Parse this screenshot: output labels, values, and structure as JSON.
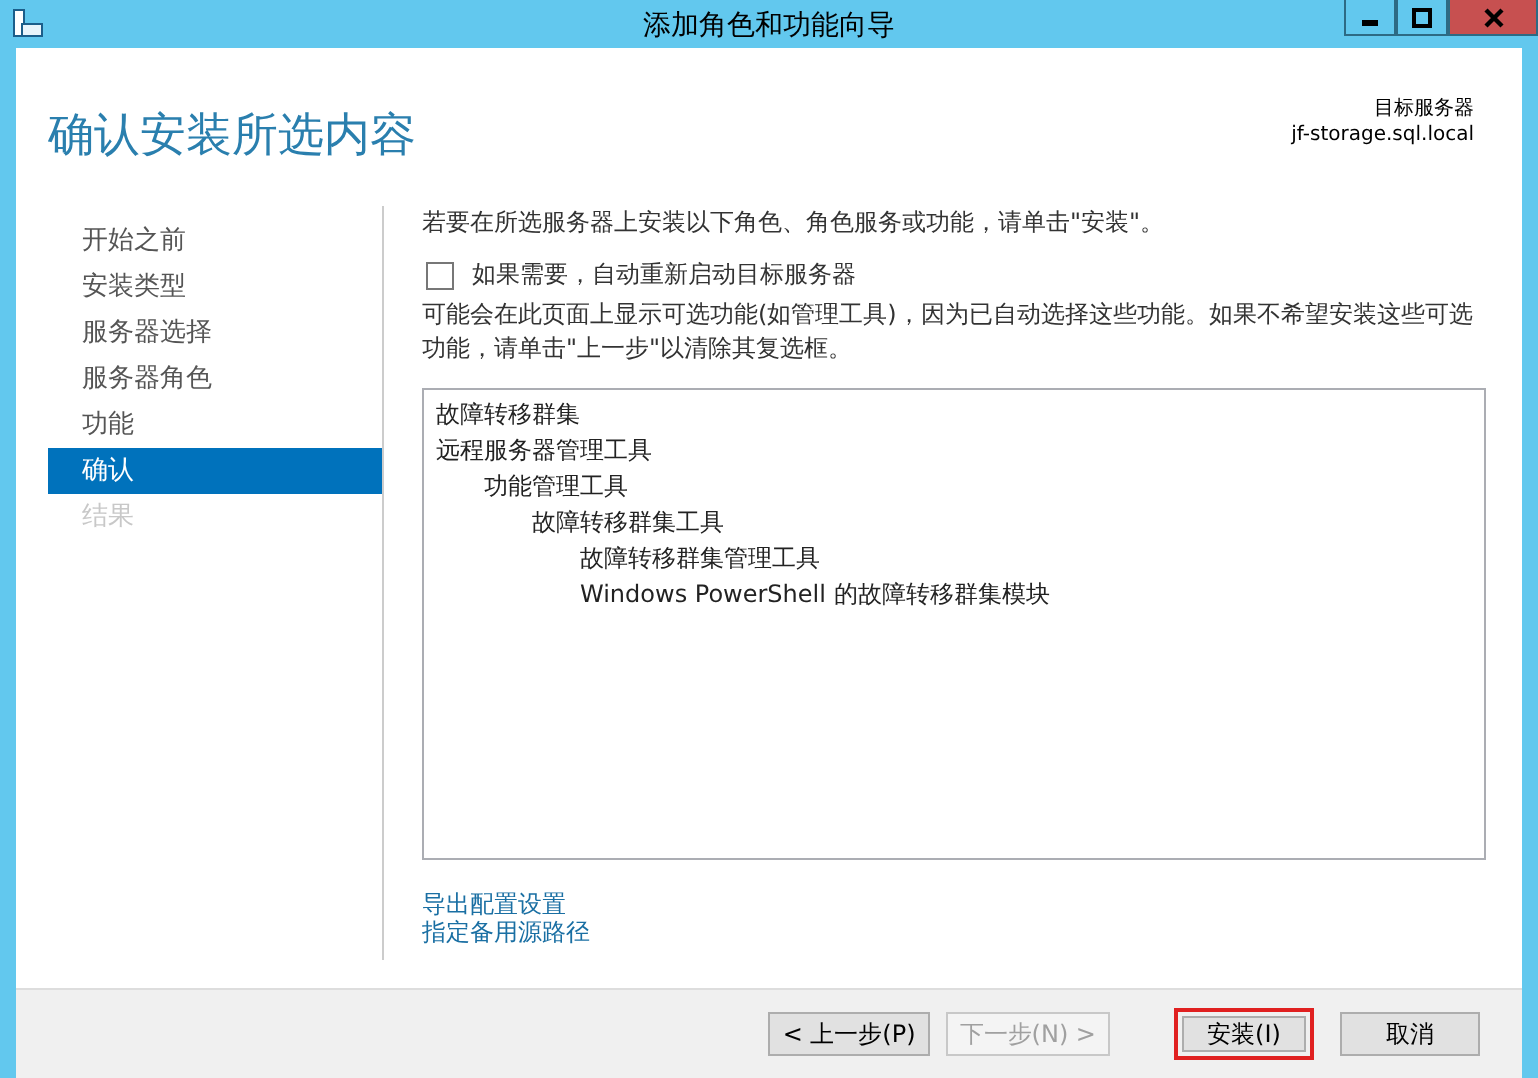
{
  "window": {
    "title": "添加角色和功能向导"
  },
  "page_title": "确认安装所选内容",
  "target_server": {
    "label": "目标服务器",
    "name": "jf-storage.sql.local"
  },
  "sidebar": {
    "items": [
      {
        "label": "开始之前",
        "selected": false,
        "disabled": false
      },
      {
        "label": "安装类型",
        "selected": false,
        "disabled": false
      },
      {
        "label": "服务器选择",
        "selected": false,
        "disabled": false
      },
      {
        "label": "服务器角色",
        "selected": false,
        "disabled": false
      },
      {
        "label": "功能",
        "selected": false,
        "disabled": false
      },
      {
        "label": "确认",
        "selected": true,
        "disabled": false
      },
      {
        "label": "结果",
        "selected": false,
        "disabled": true
      }
    ]
  },
  "intro": "若要在所选服务器上安装以下角色、角色服务或功能，请单击\"安装\"。",
  "restart": {
    "label": "如果需要，自动重新启动目标服务器",
    "checked": false
  },
  "note": "可能会在此页面上显示可选功能(如管理工具)，因为已自动选择这些功能。如果不希望安装这些可选功能，请单击\"上一步\"以清除其复选框。",
  "selection": [
    {
      "label": "故障转移群集"
    },
    {
      "label": "远程服务器管理工具",
      "children": [
        {
          "label": "功能管理工具",
          "children": [
            {
              "label": "故障转移群集工具",
              "children": [
                {
                  "label": "故障转移群集管理工具"
                },
                {
                  "label": "Windows PowerShell 的故障转移群集模块"
                }
              ]
            }
          ]
        }
      ]
    }
  ],
  "links": [
    "导出配置设置",
    "指定备用源路径"
  ],
  "buttons": [
    {
      "label": "< 上一步(P)",
      "disabled": false,
      "highlighted": false
    },
    {
      "label": "下一步(N) >",
      "disabled": true,
      "highlighted": false
    },
    {
      "label": "安装(I)",
      "disabled": false,
      "highlighted": true
    },
    {
      "label": "取消",
      "disabled": false,
      "highlighted": false
    }
  ]
}
